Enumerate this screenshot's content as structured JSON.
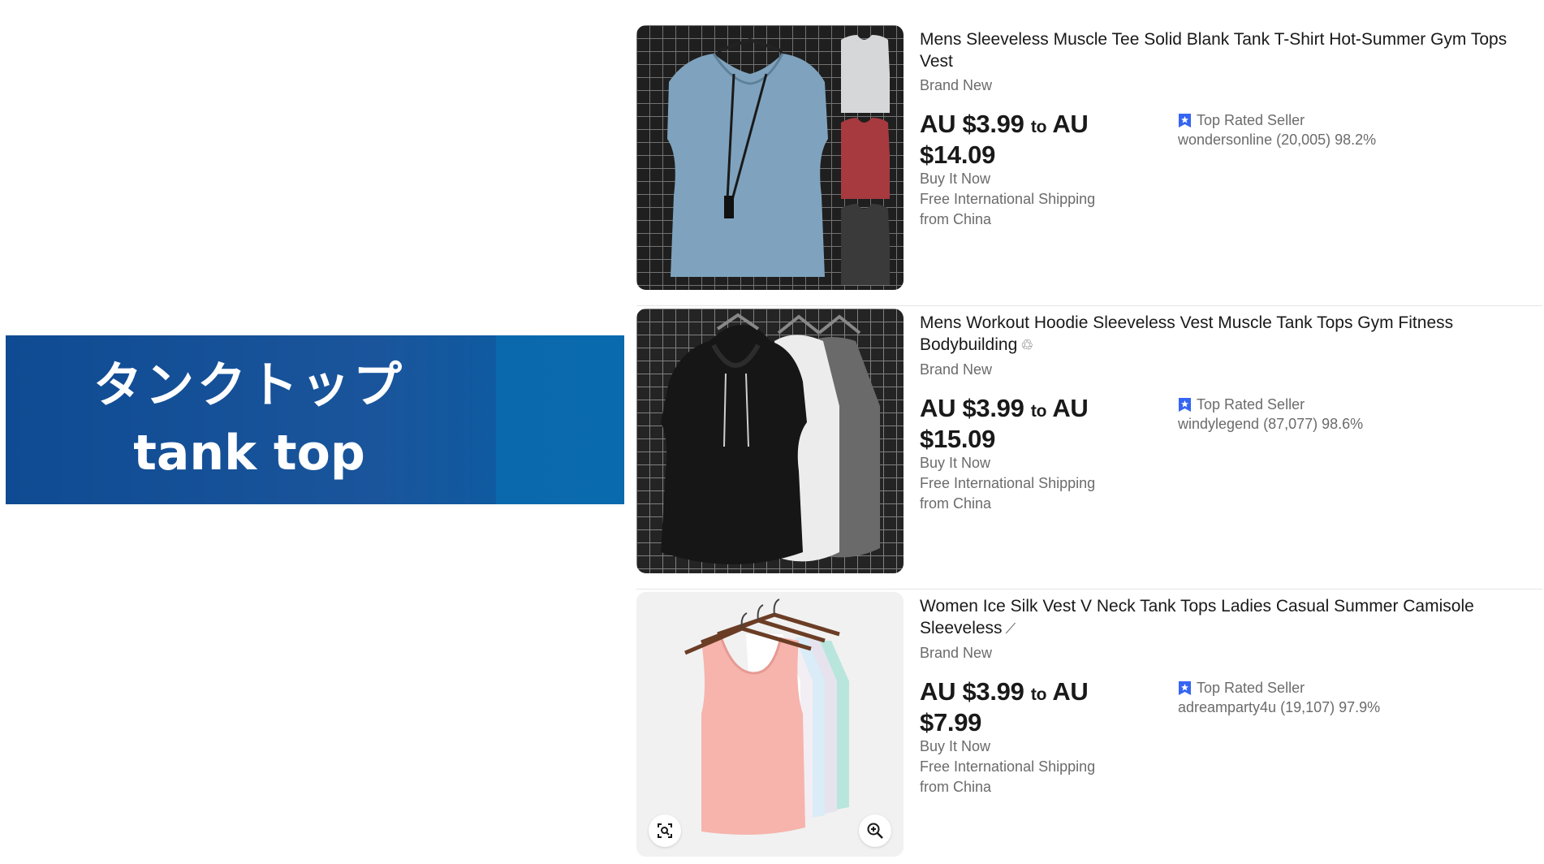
{
  "banner": {
    "japanese": "タンクトップ",
    "english": "tank top"
  },
  "listings": [
    {
      "title": "Mens Sleeveless Muscle Tee Solid Blank Tank T-Shirt Hot-Summer Gym Tops Vest",
      "title_mark": "",
      "condition": "Brand New",
      "price_from": "AU $3.99",
      "price_to_word": "to",
      "price_to_prefix": "AU",
      "price_to": "$14.09",
      "format": "Buy It Now",
      "shipping": "Free International Shipping",
      "location": "from China",
      "badge": "Top Rated Seller",
      "seller": "wondersonline (20,005) 98.2%"
    },
    {
      "title": "Mens Workout Hoodie Sleeveless Vest Muscle Tank Tops Gym Fitness Bodybuilding",
      "title_mark": "♲",
      "condition": "Brand New",
      "price_from": "AU $3.99",
      "price_to_word": "to",
      "price_to_prefix": "AU",
      "price_to": "$15.09",
      "format": "Buy It Now",
      "shipping": "Free International Shipping",
      "location": "from China",
      "badge": "Top Rated Seller",
      "seller": "windylegend (87,077) 98.6%"
    },
    {
      "title": "Women Ice Silk Vest V Neck Tank Tops Ladies Casual Summer Camisole Sleeveless",
      "title_mark": "⟋",
      "condition": "Brand New",
      "price_from": "AU $3.99",
      "price_to_word": "to",
      "price_to_prefix": "AU",
      "price_to": "$7.99",
      "format": "Buy It Now",
      "shipping": "Free International Shipping",
      "location": "from China",
      "badge": "Top Rated Seller",
      "seller": "adreamparty4u (19,107) 97.9%"
    }
  ],
  "icons": {
    "badge_icon": "top-rated-seller-icon",
    "visual_search": "visual-search-icon",
    "zoom": "zoom-in-icon"
  },
  "colors": {
    "banner_blue": "#1a559c",
    "badge_blue": "#3665f3",
    "text_primary": "#191919",
    "text_secondary": "#6b6b6b"
  }
}
